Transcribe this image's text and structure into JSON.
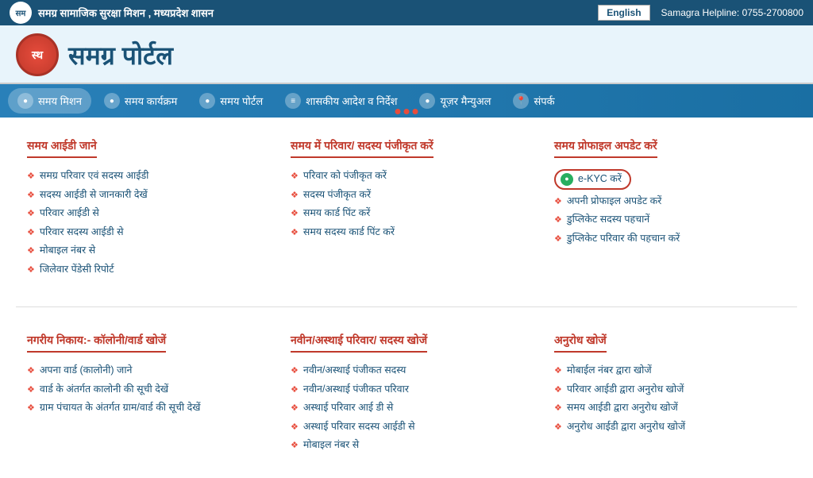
{
  "topbar": {
    "logo_text": "सम",
    "title": "समग्र सामाजिक सुरक्षा मिशन , मध्यप्रदेश शासन",
    "lang_button": "English",
    "helpline": "Samagra Helpline: 0755-2700800"
  },
  "header": {
    "logo_text": "सम",
    "portal_title": "समग्र पोर्टल"
  },
  "nav": {
    "items": [
      {
        "label": "समय मिशन",
        "icon": "●"
      },
      {
        "label": "समय कार्यक्रम",
        "icon": "●"
      },
      {
        "label": "समय पोर्टल",
        "icon": "●"
      },
      {
        "label": "शासकीय आदेश व निर्देश",
        "icon": "≡"
      },
      {
        "label": "यूज़र मैन्युअल",
        "icon": "●"
      },
      {
        "label": "संपर्क",
        "icon": "📍"
      }
    ],
    "dots": [
      "#e74c3c",
      "#e74c3c",
      "#e74c3c"
    ]
  },
  "sections": [
    {
      "id": "samay-id",
      "title": "समय आईडी जाने",
      "links": [
        "समग्र परिवार एवं सदस्य आईडी",
        "सदस्य आईडी से जानकारी देखें",
        "परिवार आईडी से",
        "परिवार सदस्य आईडी से",
        "मोबाइल नंबर से",
        "जिलेवार पेंडेसी रिपोर्ट"
      ]
    },
    {
      "id": "register-family",
      "title": "समय में परिवार/ सदस्य पंजीकृत करें",
      "links": [
        "परिवार को पंजीकृत करें",
        "सदस्य पंजीकृत करें",
        "समय कार्ड पिंट करें",
        "समय सदस्य कार्ड पिंट करें"
      ]
    },
    {
      "id": "profile-update",
      "title": "समय प्रोफाइल अपडेट करें",
      "highlighted_link": "e-KYC करें",
      "links": [
        "अपनी प्रोफाइल अपडेट करें",
        "डुप्लिकेट सदस्य पहचानें",
        "डुप्लिकेट परिवार की पहचान करें"
      ]
    },
    {
      "id": "ward-search",
      "title": "नगरीय निकाय:- कॉलोनी/वार्ड खोजें",
      "links": [
        "अपना वार्ड (कालोनी) जाने",
        "वार्ड के अंतर्गत कालोनी की सूची देखें",
        "ग्राम पंचायत के अंतर्गत ग्राम/वार्ड की सूची देखें"
      ]
    },
    {
      "id": "new-family",
      "title": "नवीन/अस्थाई परिवार/ सदस्य खोजें",
      "links": [
        "नवीन/अस्थाई पंजीकत सदस्य",
        "नवीन/अस्थाई पंजीकत परिवार",
        "अस्थाई परिवार आई डी से",
        "अस्थाई परिवार सदस्य आईडी से",
        "मोबाइल नंबर से"
      ]
    },
    {
      "id": "request-search",
      "title": "अनुरोध खोजें",
      "links": [
        "मोबाईल नंबर द्वारा खोजें",
        "परिवार आईडी द्वारा अनुरोध खोजें",
        "समय आईडी द्वारा अनुरोध खोजें",
        "अनुरोध आईडी द्वारा अनुरोध खोजें"
      ]
    }
  ]
}
